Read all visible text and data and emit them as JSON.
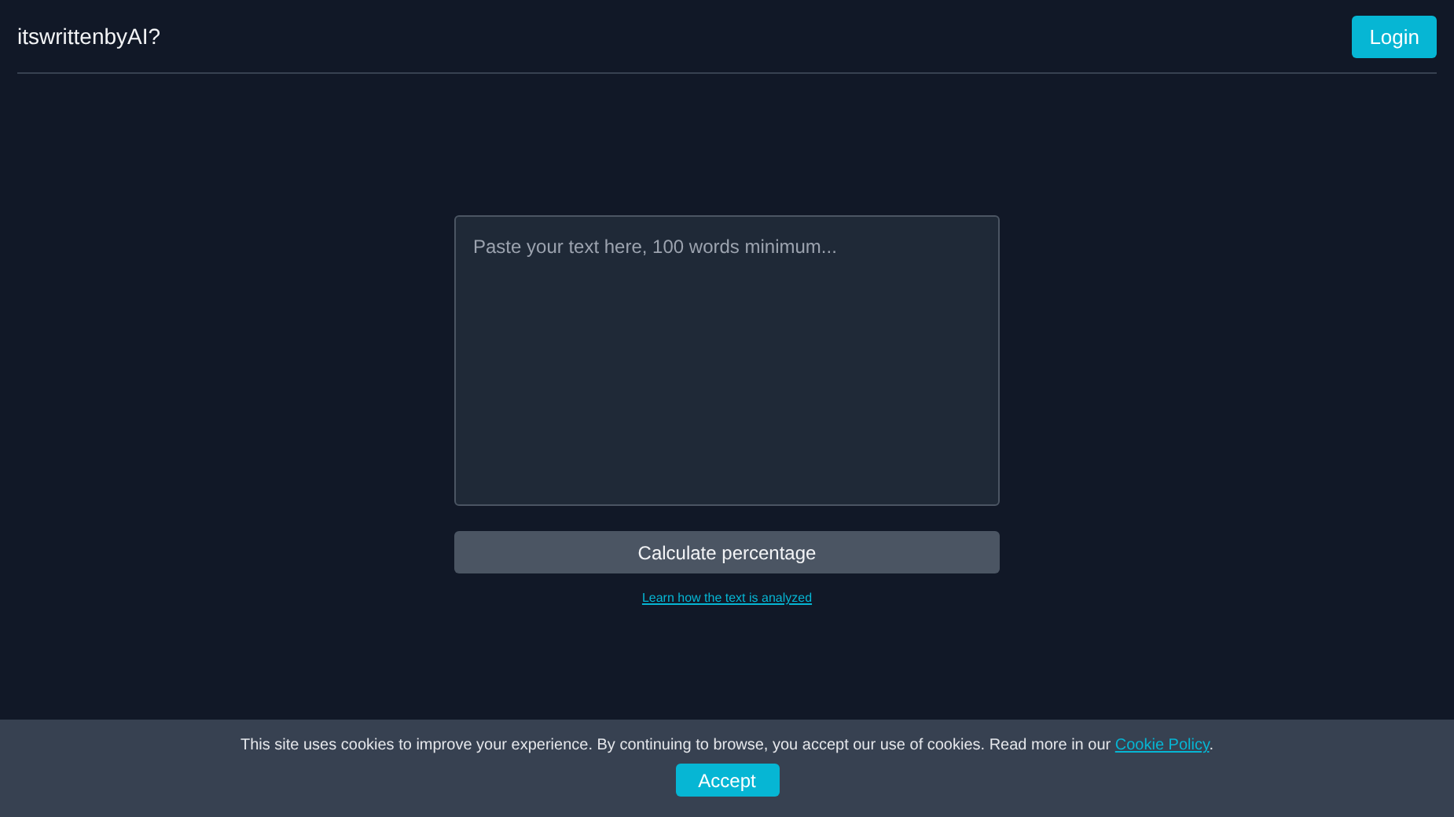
{
  "header": {
    "brand": "itswrittenbyAI?",
    "login_button": "Login"
  },
  "analyzer": {
    "placeholder": "Paste your text here, 100 words minimum...",
    "submit_button": "Calculate percentage",
    "help_link": "Learn how the text is analyzed"
  },
  "cookie_banner": {
    "text_before": "This site uses cookies to improve your experience. By continuing to browse, you accept our use of cookies. Read more in our ",
    "link": "Cookie Policy",
    "text_after": ".",
    "accept_button": "Accept"
  }
}
